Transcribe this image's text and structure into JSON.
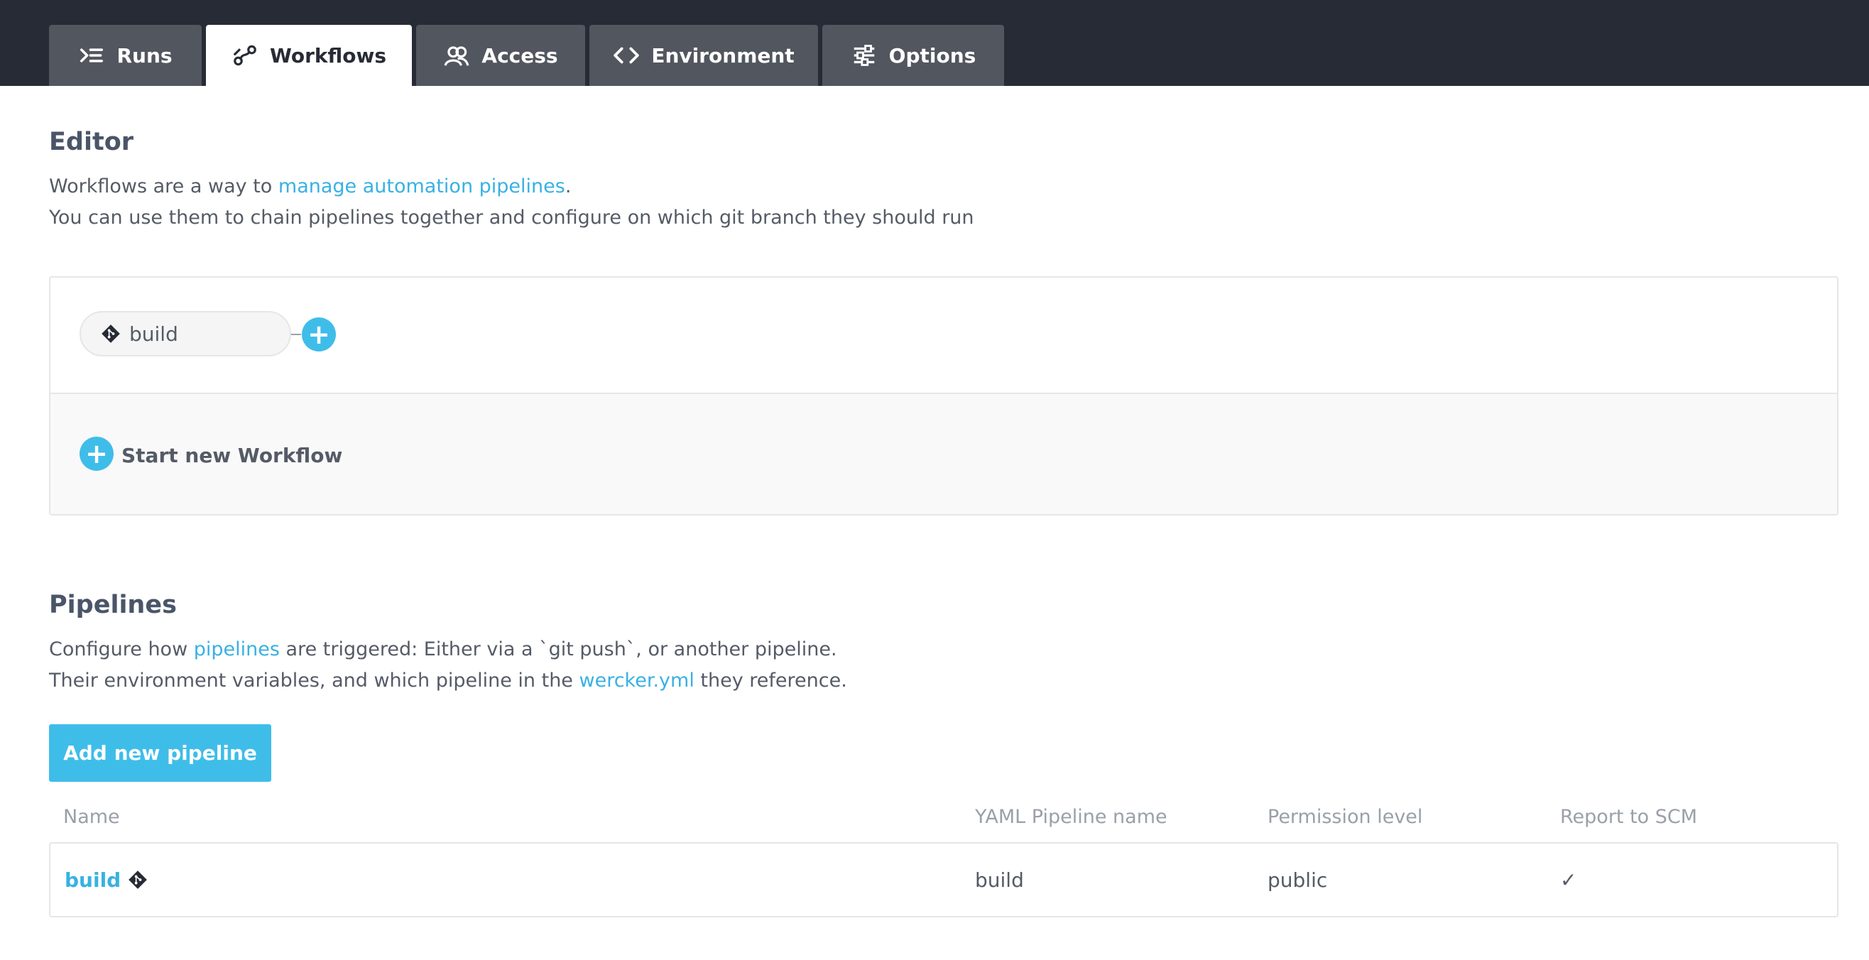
{
  "tabs": [
    {
      "label": "Runs",
      "icon": "runs-icon"
    },
    {
      "label": "Workflows",
      "icon": "workflow-icon",
      "active": true
    },
    {
      "label": "Access",
      "icon": "access-icon"
    },
    {
      "label": "Environment",
      "icon": "code-icon"
    },
    {
      "label": "Options",
      "icon": "options-icon"
    }
  ],
  "editor": {
    "title": "Editor",
    "line1_prefix": "Workflows are a way to ",
    "line1_link": "manage automation pipelines",
    "line1_suffix": ".",
    "line2": "You can use them to chain pipelines together and configure on which git branch they should run",
    "workflow_node": "build",
    "add_symbol": "+",
    "start_new": "Start new Workflow"
  },
  "pipelines": {
    "title": "Pipelines",
    "line1_prefix": "Configure how ",
    "line1_link": "pipelines",
    "line1_suffix": " are triggered: Either via a `git push`, or another pipeline.",
    "line2_prefix": "Their environment variables, and which pipeline in the ",
    "line2_link": "wercker.yml",
    "line2_suffix": " they reference.",
    "add_button": "Add new pipeline",
    "columns": [
      "Name",
      "YAML Pipeline name",
      "Permission level",
      "Report to SCM"
    ],
    "rows": [
      {
        "name": "build",
        "yaml": "build",
        "permission": "public",
        "report": "✓"
      }
    ]
  },
  "colors": {
    "accent": "#3fbde9",
    "topbar": "#272b35",
    "tab_inactive": "#52565f"
  }
}
